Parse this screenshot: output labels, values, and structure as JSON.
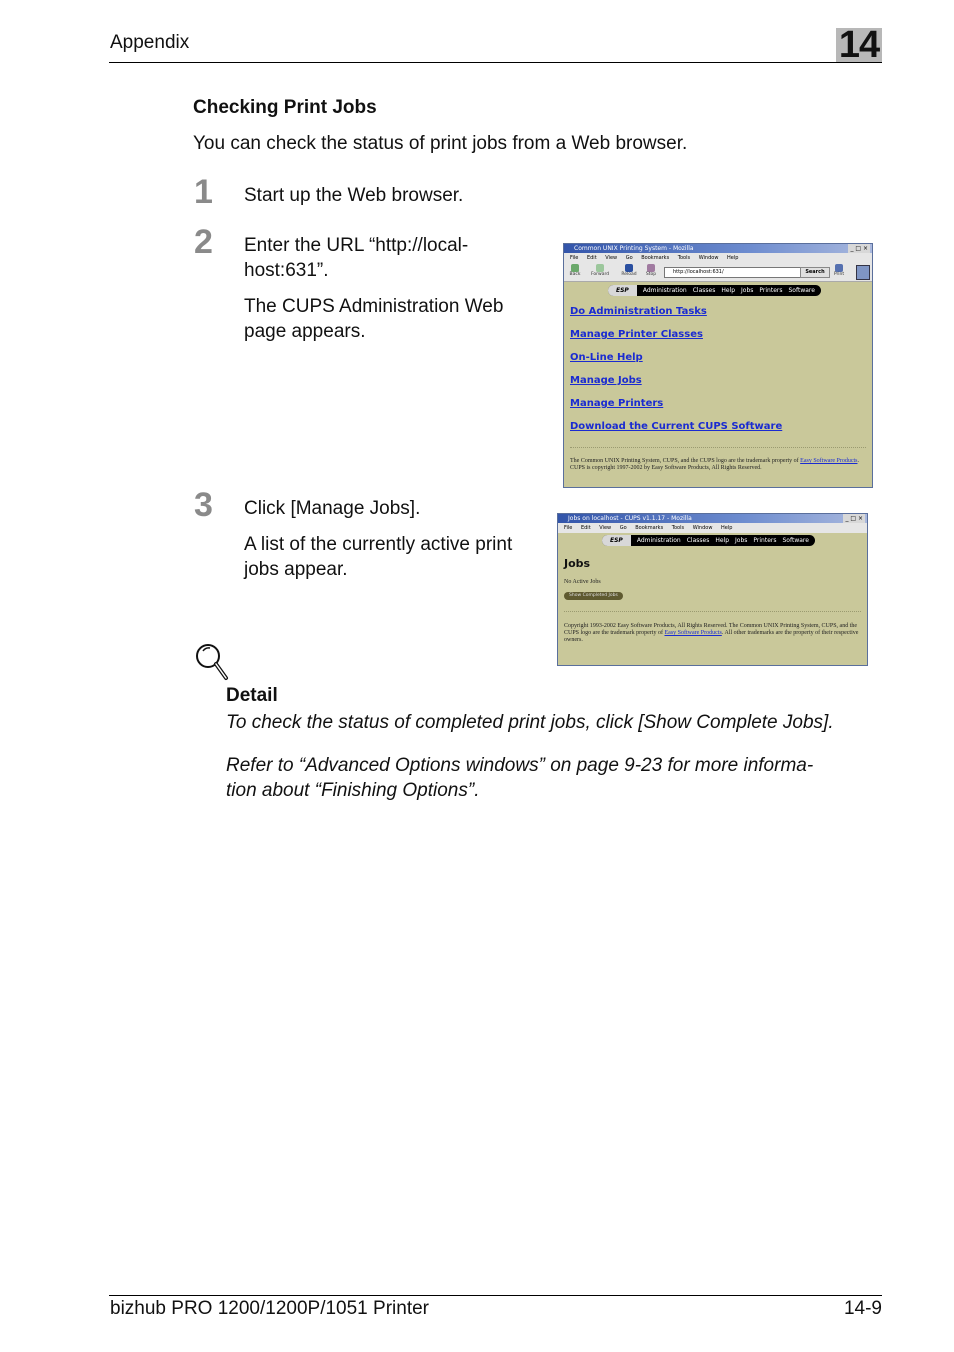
{
  "header": {
    "section": "Appendix",
    "chapter": "14"
  },
  "section": {
    "title": "Checking Print Jobs",
    "intro": "You can check the status of print jobs from a Web browser."
  },
  "steps": [
    {
      "num": "1",
      "lines": [
        "Start up the Web browser."
      ]
    },
    {
      "num": "2",
      "lines": [
        "Enter the URL “http://local-",
        "host:631”."
      ],
      "sub": [
        "The CUPS Administration Web",
        "page appears."
      ]
    },
    {
      "num": "3",
      "lines": [
        "Click [Manage Jobs]."
      ],
      "sub": [
        "A list of the currently active print",
        "jobs appear."
      ]
    }
  ],
  "browser1": {
    "title": "Common UNIX Printing System - Mozilla",
    "window_controls": "_ □ ×",
    "menu": [
      "File",
      "Edit",
      "View",
      "Go",
      "Bookmarks",
      "Tools",
      "Window",
      "Help"
    ],
    "toolbar": [
      "Back",
      "Forward",
      "Reload",
      "Stop"
    ],
    "url": "http://localhost:631/",
    "search": "Search",
    "print": "Print",
    "nav": {
      "esp": "ESP",
      "items": [
        "Administration",
        "Classes",
        "Help",
        "Jobs",
        "Printers",
        "Software"
      ]
    },
    "links": [
      "Do Administration Tasks",
      "Manage Printer Classes",
      "On-Line Help",
      "Manage Jobs",
      "Manage Printers",
      "Download the Current CUPS Software"
    ],
    "footer_text1": "The Common UNIX Printing System, CUPS, and the CUPS logo are the trademark property of ",
    "footer_link": "Easy Software Products",
    "footer_text2": ". CUPS is copyright 1997-2002 by Easy Software Products, All Rights Reserved."
  },
  "browser2": {
    "title": "Jobs on localhost - CUPS v1.1.17 - Mozilla",
    "window_controls": "_ □ ×",
    "menu": [
      "File",
      "Edit",
      "View",
      "Go",
      "Bookmarks",
      "Tools",
      "Window",
      "Help"
    ],
    "nav": {
      "esp": "ESP",
      "items": [
        "Administration",
        "Classes",
        "Help",
        "Jobs",
        "Printers",
        "Software"
      ]
    },
    "heading": "Jobs",
    "status": "No Active Jobs",
    "button": "Show Completed Jobs",
    "footer_text1": "Copyright 1993-2002 Easy Software Products, All Rights Reserved. The Common UNIX Printing System, CUPS, and the CUPS logo are the trademark property of ",
    "footer_link": "Easy Software Products",
    "footer_text2": ". All other trademarks are the property of their respective owners."
  },
  "detail": {
    "title": "Detail",
    "lines": [
      "To check the status of completed print jobs, click [Show Complete Jobs].",
      "Refer to “Advanced Options windows” on page 9-23 for more informa-",
      "tion about “Finishing Options”."
    ]
  },
  "footer": {
    "product": "bizhub PRO 1200/1200P/1051 Printer",
    "page": "14-9"
  }
}
